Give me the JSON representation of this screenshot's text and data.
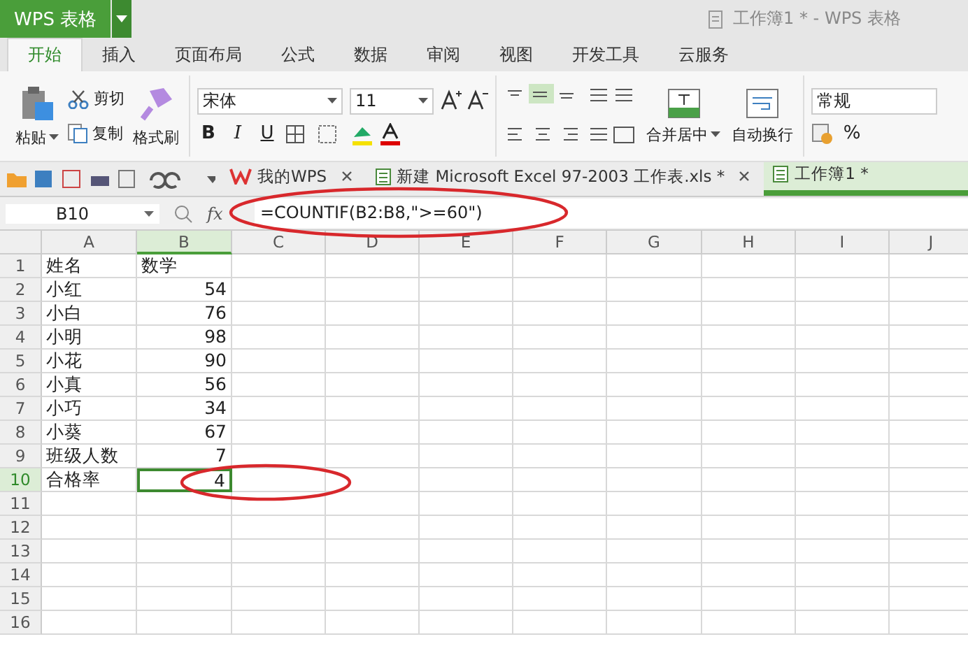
{
  "app_menu": {
    "label": "WPS 表格"
  },
  "window": {
    "title": "工作簿1 * - WPS 表格"
  },
  "ribbon_tabs": [
    {
      "label": "开始",
      "selected": true
    },
    {
      "label": "插入",
      "selected": false
    },
    {
      "label": "页面布局",
      "selected": false
    },
    {
      "label": "公式",
      "selected": false
    },
    {
      "label": "数据",
      "selected": false
    },
    {
      "label": "审阅",
      "selected": false
    },
    {
      "label": "视图",
      "selected": false
    },
    {
      "label": "开发工具",
      "selected": false
    },
    {
      "label": "云服务",
      "selected": false
    }
  ],
  "clipboard": {
    "paste": "粘贴",
    "cut": "剪切",
    "copy": "复制",
    "format_painter": "格式刷"
  },
  "font": {
    "name": "宋体",
    "size": "11",
    "bold": "B",
    "italic": "I",
    "underline": "U"
  },
  "alignment": {
    "merge": "合并居中",
    "wrap": "自动换行"
  },
  "number": {
    "format": "常规",
    "percent": "%"
  },
  "doc_tabs": [
    {
      "label": "我的WPS",
      "kind": "home",
      "selected": false
    },
    {
      "label": "新建 Microsoft Excel 97-2003 工作表.xls *",
      "kind": "sheet",
      "selected": false
    },
    {
      "label": "工作簿1 *",
      "kind": "sheet",
      "selected": true
    }
  ],
  "formula_bar": {
    "cell": "B10",
    "fx": "fx",
    "formula": "=COUNTIF(B2:B8,\">=60\")"
  },
  "columns": [
    {
      "label": "A",
      "selected": false
    },
    {
      "label": "B",
      "selected": true
    },
    {
      "label": "C",
      "selected": false
    },
    {
      "label": "D",
      "selected": false
    },
    {
      "label": "E",
      "selected": false
    },
    {
      "label": "F",
      "selected": false
    },
    {
      "label": "G",
      "selected": false
    },
    {
      "label": "H",
      "selected": false
    },
    {
      "label": "I",
      "selected": false
    },
    {
      "label": "J",
      "selected": false
    }
  ],
  "rows": [
    {
      "label": "1",
      "selected": false,
      "cells": [
        "姓名",
        "数学"
      ]
    },
    {
      "label": "2",
      "selected": false,
      "cells": [
        "小红",
        "54"
      ]
    },
    {
      "label": "3",
      "selected": false,
      "cells": [
        "小白",
        "76"
      ]
    },
    {
      "label": "4",
      "selected": false,
      "cells": [
        "小明",
        "98"
      ]
    },
    {
      "label": "5",
      "selected": false,
      "cells": [
        "小花",
        "90"
      ]
    },
    {
      "label": "6",
      "selected": false,
      "cells": [
        "小真",
        "56"
      ]
    },
    {
      "label": "7",
      "selected": false,
      "cells": [
        "小巧",
        "34"
      ]
    },
    {
      "label": "8",
      "selected": false,
      "cells": [
        "小葵",
        "67"
      ]
    },
    {
      "label": "9",
      "selected": false,
      "cells": [
        "班级人数",
        "7"
      ]
    },
    {
      "label": "10",
      "selected": true,
      "cells": [
        "合格率",
        "4"
      ]
    },
    {
      "label": "11",
      "selected": false,
      "cells": []
    },
    {
      "label": "12",
      "selected": false,
      "cells": []
    },
    {
      "label": "13",
      "selected": false,
      "cells": []
    },
    {
      "label": "14",
      "selected": false,
      "cells": []
    },
    {
      "label": "15",
      "selected": false,
      "cells": []
    },
    {
      "label": "16",
      "selected": false,
      "cells": []
    }
  ]
}
